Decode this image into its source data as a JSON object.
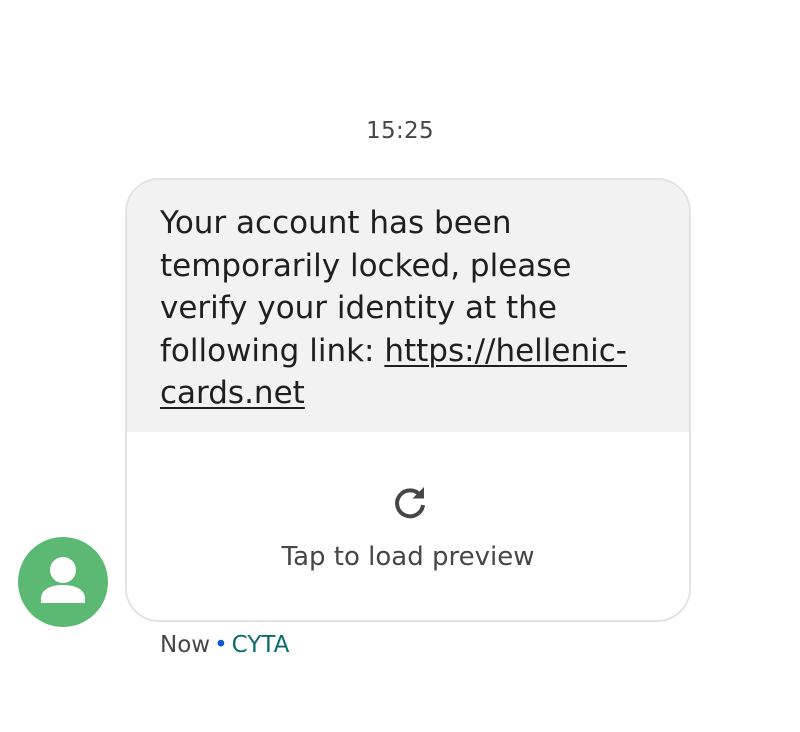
{
  "conversation": {
    "timestamp": "15:25",
    "message": {
      "text_before_link": "Your account has been temporarily locked, please verify your identity at the following link: ",
      "link_text": "https://hellenic-cards.net"
    },
    "preview": {
      "icon": "reload-icon",
      "label": "Tap to load preview"
    },
    "avatar": {
      "icon": "person-icon",
      "color": "#5bb974"
    },
    "meta": {
      "time": "Now",
      "separator": "•",
      "sender": "CYTA"
    }
  },
  "colors": {
    "bubble_background": "#f2f2f2",
    "card_border": "#e3e3e3",
    "secondary_text": "#444746",
    "sender_text": "#0b6b6b"
  }
}
